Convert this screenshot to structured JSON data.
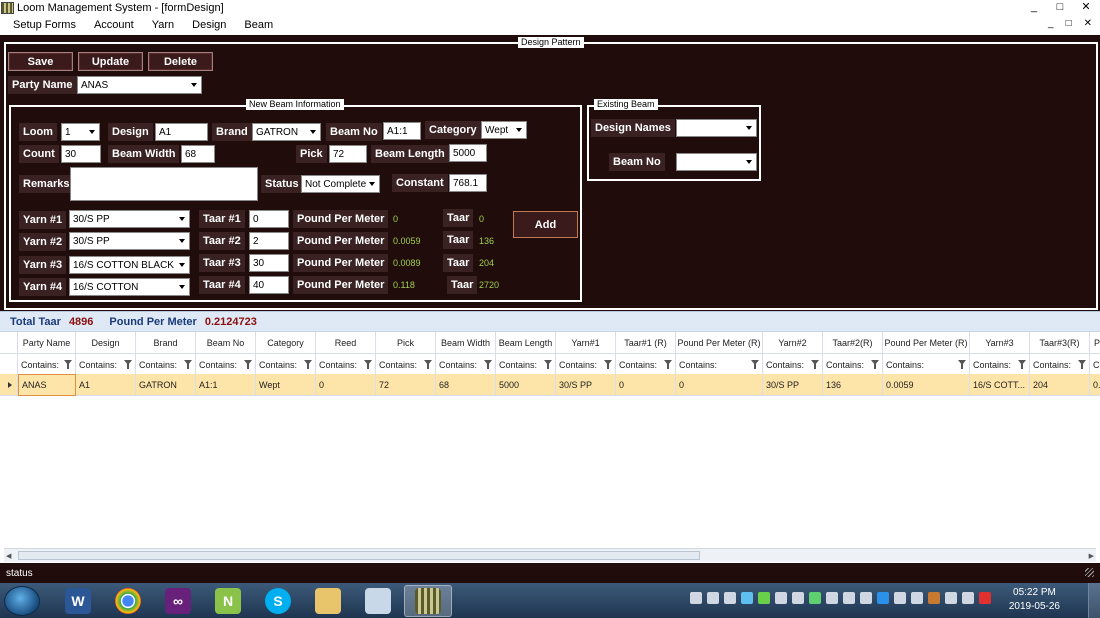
{
  "window": {
    "title": "Loom Management System - [formDesign]",
    "controls": [
      "_",
      "□",
      "✕"
    ]
  },
  "menu": [
    "Setup Forms",
    "Account",
    "Yarn",
    "Design",
    "Beam"
  ],
  "mdi_controls": [
    "_",
    "□",
    "✕"
  ],
  "design_pattern": {
    "title": "Design Pattern"
  },
  "toolbar": {
    "save": "Save",
    "update": "Update",
    "delete": "Delete"
  },
  "party": {
    "label": "Party Name",
    "value": "ANAS"
  },
  "new_beam": {
    "title": "New Beam Information",
    "loom_label": "Loom",
    "loom_value": "1",
    "design_label": "Design",
    "design_value": "A1",
    "brand_label": "Brand",
    "brand_value": "GATRON",
    "beam_no_label": "Beam No",
    "beam_no_value": "A1:1",
    "category_label": "Category",
    "category_value": "Wept",
    "count_label": "Count",
    "count_value": "30",
    "beam_width_label": "Beam Width",
    "beam_width_value": "68",
    "pick_label": "Pick",
    "pick_value": "72",
    "beam_length_label": "Beam Length",
    "beam_length_value": "5000",
    "remarks_label": "Remarks",
    "remarks_value": "",
    "status_label": "Status",
    "status_value": "Not Complete",
    "constant_label": "Constant",
    "constant_value": "768.1",
    "add_label": "Add",
    "yarns": [
      {
        "label": "Yarn #1",
        "yarn": "30/S PP",
        "taar_label": "Taar #1",
        "taar": "0",
        "ppm_label": "Pound Per Meter",
        "ppm": "0",
        "t_label": "Taar",
        "t": "0"
      },
      {
        "label": "Yarn #2",
        "yarn": "30/S PP",
        "taar_label": "Taar #2",
        "taar": "2",
        "ppm_label": "Pound Per Meter",
        "ppm": "0.0059",
        "t_label": "Taar",
        "t": "136"
      },
      {
        "label": "Yarn #3",
        "yarn": "16/S COTTON BLACK",
        "taar_label": "Taar #3",
        "taar": "30",
        "ppm_label": "Pound Per Meter",
        "ppm": "0.0089",
        "t_label": "Taar",
        "t": "204"
      },
      {
        "label": "Yarn #4",
        "yarn": "16/S COTTON",
        "taar_label": "Taar #4",
        "taar": "40",
        "ppm_label": "Pound Per Meter",
        "ppm": "0.118",
        "t_label": "Taar",
        "t": "2720"
      }
    ]
  },
  "existing_beam": {
    "title": "Existing Beam",
    "design_names_label": "Design Names",
    "design_names_value": "",
    "beam_no_label": "Beam No",
    "beam_no_value": ""
  },
  "totals": {
    "total_taar_label": "Total Taar",
    "total_taar": "4896",
    "ppm_label": "Pound Per Meter",
    "ppm": "0.2124723"
  },
  "grid": {
    "columns": [
      "Party Name",
      "Design",
      "Brand",
      "Beam No",
      "Category",
      "Reed",
      "Pick",
      "Beam Width",
      "Beam Length",
      "Yarn#1",
      "Taar#1 (R)",
      "Pound Per Meter (R)",
      "Yarn#2",
      "Taar#2(R)",
      "Pound Per Meter (R)",
      "Yarn#3",
      "Taar#3(R)",
      "Po"
    ],
    "filter_text": "Contains:",
    "rows": [
      [
        "ANAS",
        "A1",
        "GATRON",
        "A1:1",
        "Wept",
        "0",
        "72",
        "68",
        "5000",
        "30/S PP",
        "0",
        "0",
        "30/S PP",
        "136",
        "0.0059",
        "16/S COTT...",
        "204",
        "0."
      ]
    ]
  },
  "statusbar": {
    "text": "status"
  },
  "taskbar": {
    "clock_time": "05:22 PM",
    "clock_date": "2019-05-26",
    "apps": [
      "Word",
      "Chrome",
      "Visual Studio",
      "Notepad++",
      "Skype",
      "Explorer",
      "Paint",
      "Loom Management System"
    ]
  }
}
